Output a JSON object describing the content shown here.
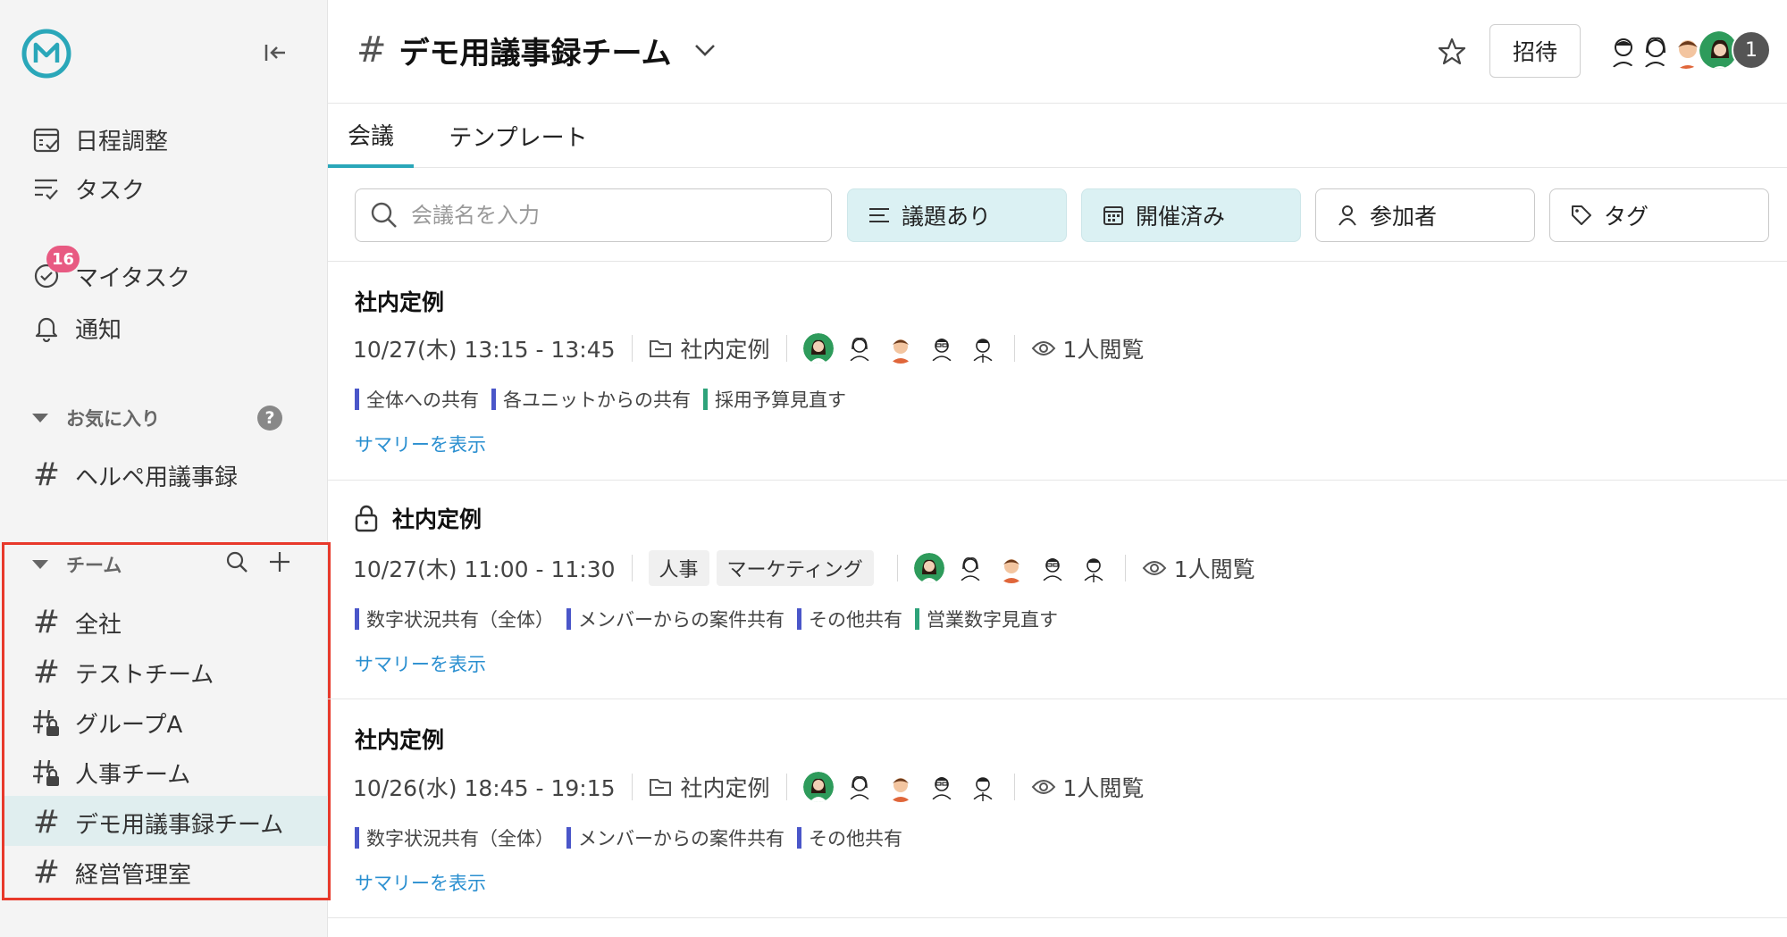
{
  "sidebar": {
    "nav": [
      {
        "label": "日程調整",
        "icon": "calendar-check-icon"
      },
      {
        "label": "タスク",
        "icon": "task-list-icon"
      },
      {
        "label": "マイタスク",
        "icon": "check-circle-icon",
        "badge": "16"
      },
      {
        "label": "通知",
        "icon": "bell-icon"
      }
    ],
    "favorites": {
      "heading": "お気に入り",
      "help": "?",
      "items": [
        {
          "label": "ヘルペ用議事録",
          "icon": "hash-icon"
        }
      ]
    },
    "teams": {
      "heading": "チーム",
      "items": [
        {
          "label": "全社",
          "icon": "hash-icon"
        },
        {
          "label": "テストチーム",
          "icon": "hash-icon"
        },
        {
          "label": "グループA",
          "icon": "hash-lock-icon"
        },
        {
          "label": "人事チーム",
          "icon": "hash-lock-icon"
        },
        {
          "label": "デモ用議事録チーム",
          "icon": "hash-icon",
          "active": true
        },
        {
          "label": "経営管理室",
          "icon": "hash-icon"
        }
      ]
    }
  },
  "header": {
    "hash": "#",
    "title": "デモ用議事録チーム",
    "invite_label": "招待",
    "member_overflow": "1"
  },
  "tabs": [
    {
      "label": "会議",
      "active": true
    },
    {
      "label": "テンプレート",
      "active": false
    }
  ],
  "filters": {
    "search_placeholder": "会議名を入力",
    "chips": [
      {
        "label": "議題あり",
        "active": true,
        "icon": "lines-icon"
      },
      {
        "label": "開催済み",
        "active": true,
        "icon": "calendar-icon"
      },
      {
        "label": "参加者",
        "active": false,
        "icon": "person-icon"
      },
      {
        "label": "タグ",
        "active": false,
        "icon": "tag-icon"
      }
    ]
  },
  "meetings": [
    {
      "title": "社内定例",
      "locked": false,
      "datetime": "10/27(木) 13:15 - 13:45",
      "folder": "社内定例",
      "tags": [],
      "viewers": "1人閲覧",
      "topics": [
        {
          "label": "全体への共有",
          "color": "blue"
        },
        {
          "label": "各ユニットからの共有",
          "color": "blue"
        },
        {
          "label": "採用予算見直す",
          "color": "green"
        }
      ],
      "summary_link": "サマリーを表示"
    },
    {
      "title": "社内定例",
      "locked": true,
      "datetime": "10/27(木) 11:00 - 11:30",
      "folder": "",
      "tags": [
        "人事",
        "マーケティング"
      ],
      "viewers": "1人閲覧",
      "topics": [
        {
          "label": "数字状況共有（全体）",
          "color": "blue"
        },
        {
          "label": "メンバーからの案件共有",
          "color": "blue"
        },
        {
          "label": "その他共有",
          "color": "blue"
        },
        {
          "label": "営業数字見直す",
          "color": "green"
        }
      ],
      "summary_link": "サマリーを表示"
    },
    {
      "title": "社内定例",
      "locked": false,
      "datetime": "10/26(水) 18:45 - 19:15",
      "folder": "社内定例",
      "tags": [],
      "viewers": "1人閲覧",
      "topics": [
        {
          "label": "数字状況共有（全体）",
          "color": "blue"
        },
        {
          "label": "メンバーからの案件共有",
          "color": "blue"
        },
        {
          "label": "その他共有",
          "color": "blue"
        }
      ],
      "summary_link": "サマリーを表示"
    }
  ],
  "colors": {
    "accent": "#2aa7b9",
    "badge": "#e85a82",
    "link": "#2a8fd0",
    "highlight": "#e8392b",
    "active_row": "#e0eeef"
  }
}
